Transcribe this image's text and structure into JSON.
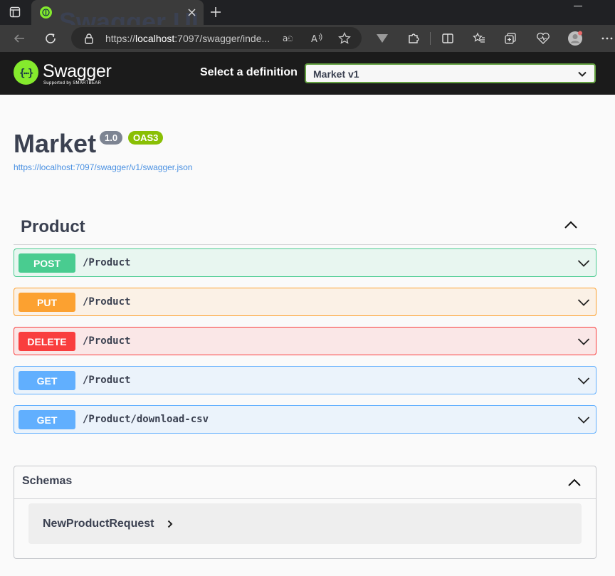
{
  "browser": {
    "tab_title": "Swagger UI",
    "url_prefix": "https://",
    "url_host": "localhost",
    "url_rest": ":7097/swagger/inde..."
  },
  "topbar": {
    "logo_text": "Swagger",
    "logo_tagline": "Supported by SMARTBEAR",
    "definition_label": "Select a definition",
    "definition_value": "Market v1"
  },
  "info": {
    "title": "Market",
    "version": "1.0",
    "oas_badge": "OAS3",
    "spec_url": "https://localhost:7097/swagger/v1/swagger.json"
  },
  "tag": {
    "name": "Product",
    "operations": [
      {
        "method": "POST",
        "path": "/Product"
      },
      {
        "method": "PUT",
        "path": "/Product"
      },
      {
        "method": "DELETE",
        "path": "/Product"
      },
      {
        "method": "GET",
        "path": "/Product"
      },
      {
        "method": "GET",
        "path": "/Product/download-csv"
      }
    ]
  },
  "schemas": {
    "title": "Schemas",
    "models": [
      {
        "name": "NewProductRequest"
      }
    ]
  },
  "colors": {
    "post": "#49cc90",
    "put": "#fca130",
    "delete": "#f93e3e",
    "get": "#61affe",
    "swagger_green": "#85ea2d"
  },
  "icons": [
    "window-icon",
    "swagger-favicon",
    "close-icon",
    "plus-icon",
    "back-icon",
    "refresh-icon",
    "lock-icon",
    "read-aloud-icon",
    "immersive-reader-icon",
    "favorite-star-icon",
    "extension-v-icon",
    "puzzle-icon",
    "split-screen-icon",
    "favorites-icon",
    "collections-icon",
    "browser-essentials-icon",
    "profile-avatar-icon",
    "more-icon",
    "chevron-down-icon",
    "chevron-up-icon",
    "chevron-right-icon"
  ]
}
